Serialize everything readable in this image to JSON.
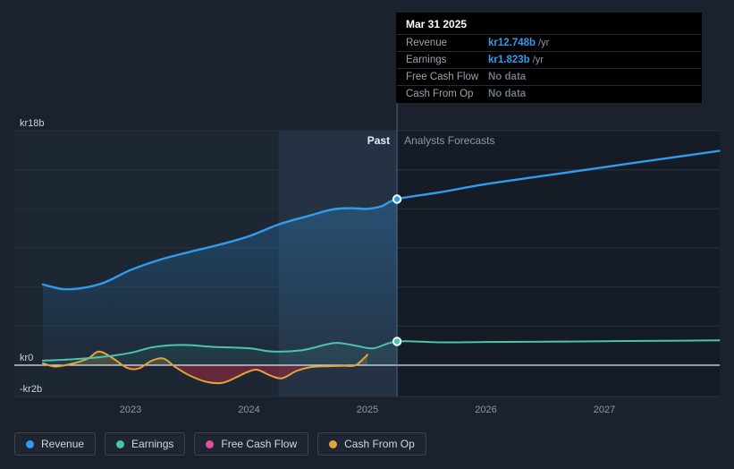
{
  "tooltip": {
    "date": "Mar 31 2025",
    "rows": [
      {
        "label": "Revenue",
        "value": "kr12.748b",
        "suffix": "/yr",
        "value_color": "#2f9ded"
      },
      {
        "label": "Earnings",
        "value": "kr1.823b",
        "suffix": "/yr",
        "value_color": "#2f9ded"
      },
      {
        "label": "Free Cash Flow",
        "value": "No data",
        "suffix": "",
        "value_color": "#6b7682"
      },
      {
        "label": "Cash From Op",
        "value": "No data",
        "suffix": "",
        "value_color": "#6b7682"
      }
    ]
  },
  "legend": [
    {
      "label": "Revenue",
      "color": "#2f9ded"
    },
    {
      "label": "Earnings",
      "color": "#4ac4ab"
    },
    {
      "label": "Free Cash Flow",
      "color": "#e04e9e"
    },
    {
      "label": "Cash From Op",
      "color": "#e2a33d"
    }
  ],
  "chart_data": {
    "type": "line",
    "title": "Past and forecast revenue, earnings and cash flow (kr billions)",
    "x_axis": {
      "ticks": [
        2023,
        2024,
        2025,
        2026,
        2027
      ],
      "labels": [
        "2023",
        "2024",
        "2025",
        "2026",
        "2027"
      ],
      "range": [
        2022.26,
        2027.97
      ]
    },
    "y_axis": {
      "unit": "kr billions",
      "labels": [
        {
          "value": 18,
          "text": "kr18b"
        },
        {
          "value": 0,
          "text": "kr0"
        },
        {
          "value": -2,
          "text": "-kr2b"
        }
      ],
      "gridlines": [
        18,
        15,
        12,
        9,
        6,
        3
      ],
      "range": [
        -2.4,
        18
      ]
    },
    "divider": {
      "x": 2025.25,
      "past_label": "Past",
      "forecast_label": "Analysts Forecasts"
    },
    "highlight_band": {
      "from": 2024.25,
      "to": 2025.25
    },
    "marker": {
      "x": 2025.25,
      "points": [
        {
          "series": "Revenue",
          "value": 12.748
        },
        {
          "series": "Earnings",
          "value": 1.823
        }
      ]
    },
    "series": [
      {
        "name": "Revenue",
        "color": "#2f9ded",
        "points": [
          [
            2022.26,
            6.2
          ],
          [
            2022.42,
            5.85
          ],
          [
            2022.58,
            5.9
          ],
          [
            2022.78,
            6.35
          ],
          [
            2023.0,
            7.3
          ],
          [
            2023.25,
            8.1
          ],
          [
            2023.5,
            8.7
          ],
          [
            2023.75,
            9.25
          ],
          [
            2024.0,
            9.9
          ],
          [
            2024.25,
            10.8
          ],
          [
            2024.5,
            11.45
          ],
          [
            2024.7,
            11.95
          ],
          [
            2024.85,
            12.05
          ],
          [
            2025.0,
            12.0
          ],
          [
            2025.12,
            12.2
          ],
          [
            2025.25,
            12.748
          ],
          [
            2025.6,
            13.25
          ],
          [
            2026.0,
            13.9
          ],
          [
            2026.5,
            14.55
          ],
          [
            2027.0,
            15.2
          ],
          [
            2027.5,
            15.85
          ],
          [
            2027.97,
            16.45
          ]
        ]
      },
      {
        "name": "Earnings",
        "color": "#4ac4ab",
        "points": [
          [
            2022.26,
            0.35
          ],
          [
            2022.5,
            0.45
          ],
          [
            2022.78,
            0.65
          ],
          [
            2023.0,
            0.95
          ],
          [
            2023.2,
            1.4
          ],
          [
            2023.45,
            1.55
          ],
          [
            2023.7,
            1.4
          ],
          [
            2024.0,
            1.3
          ],
          [
            2024.2,
            1.05
          ],
          [
            2024.45,
            1.15
          ],
          [
            2024.72,
            1.7
          ],
          [
            2024.9,
            1.5
          ],
          [
            2025.05,
            1.3
          ],
          [
            2025.25,
            1.823
          ],
          [
            2025.6,
            1.75
          ],
          [
            2026.0,
            1.78
          ],
          [
            2026.5,
            1.8
          ],
          [
            2027.0,
            1.84
          ],
          [
            2027.5,
            1.87
          ],
          [
            2027.97,
            1.9
          ]
        ]
      },
      {
        "name": "Cash From Op",
        "color": "#e2a33d",
        "past_only": true,
        "points": [
          [
            2022.26,
            0.15
          ],
          [
            2022.36,
            -0.1
          ],
          [
            2022.5,
            0.1
          ],
          [
            2022.64,
            0.5
          ],
          [
            2022.73,
            1.05
          ],
          [
            2022.84,
            0.6
          ],
          [
            2022.97,
            -0.2
          ],
          [
            2023.07,
            -0.25
          ],
          [
            2023.18,
            0.35
          ],
          [
            2023.28,
            0.5
          ],
          [
            2023.38,
            -0.15
          ],
          [
            2023.5,
            -0.8
          ],
          [
            2023.65,
            -1.3
          ],
          [
            2023.78,
            -1.35
          ],
          [
            2023.9,
            -0.9
          ],
          [
            2023.98,
            -0.55
          ],
          [
            2024.07,
            -0.35
          ],
          [
            2024.18,
            -0.8
          ],
          [
            2024.28,
            -1.0
          ],
          [
            2024.4,
            -0.45
          ],
          [
            2024.52,
            -0.15
          ],
          [
            2024.66,
            -0.08
          ],
          [
            2024.8,
            -0.05
          ],
          [
            2024.9,
            0.0
          ],
          [
            2025.0,
            0.8
          ]
        ]
      },
      {
        "name": "Free Cash Flow",
        "color": "#e04e9e",
        "points": []
      }
    ]
  }
}
